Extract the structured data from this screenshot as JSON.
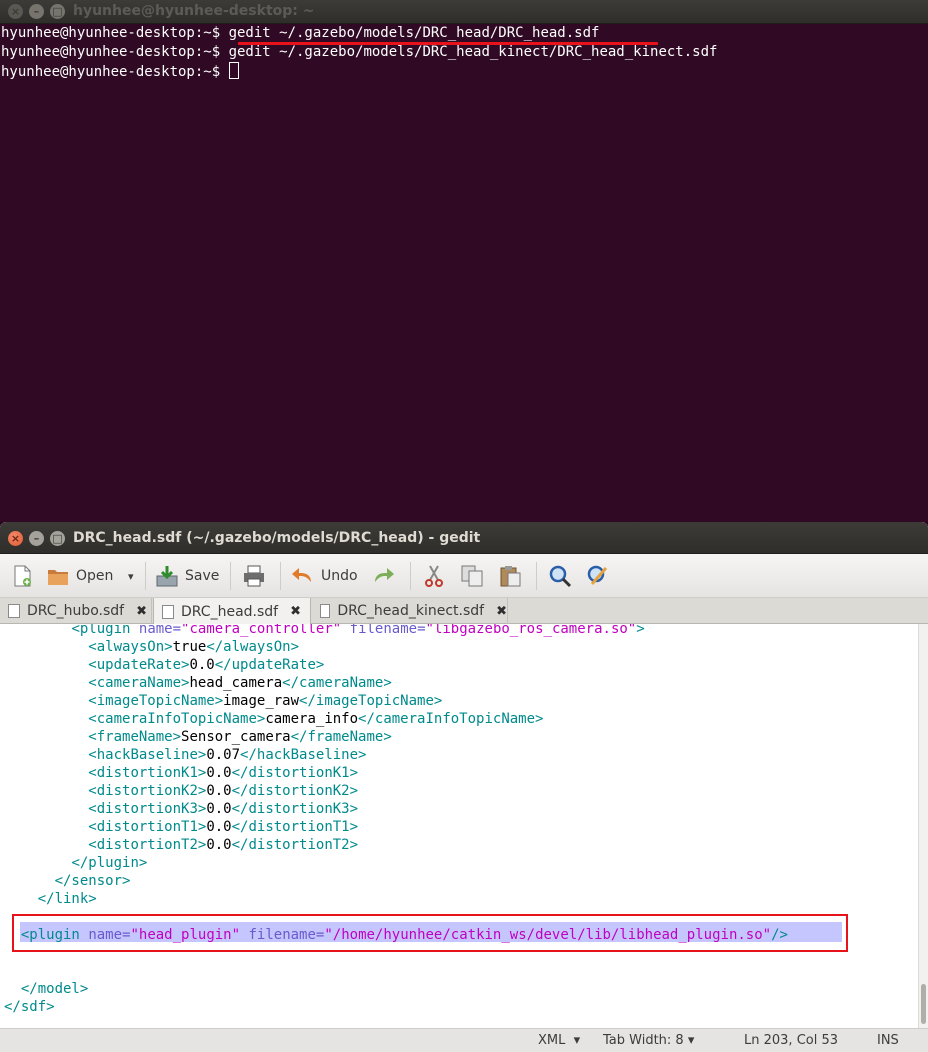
{
  "terminal": {
    "title": "hyunhee@hyunhee-desktop: ~",
    "lines": [
      {
        "prompt": "hyunhee@hyunhee-desktop:~$ ",
        "command": "gedit ~/.gazebo/models/DRC_head/DRC_head.sdf"
      },
      {
        "prompt": "hyunhee@hyunhee-desktop:~$ ",
        "command": "gedit ~/.gazebo/models/DRC_head_kinect/DRC_head_kinect.sdf"
      },
      {
        "prompt": "hyunhee@hyunhee-desktop:~$ ",
        "command": ""
      }
    ]
  },
  "gedit": {
    "title": "DRC_head.sdf (~/.gazebo/models/DRC_head) - gedit",
    "toolbar": {
      "open_label": "Open",
      "save_label": "Save",
      "undo_label": "Undo",
      "dropdown_glyph": "▾"
    },
    "tabs": [
      {
        "label": "DRC_hubo.sdf",
        "close": "✖"
      },
      {
        "label": "DRC_head.sdf",
        "close": "✖"
      },
      {
        "label": "DRC_head_kinect.sdf",
        "close": "✖"
      }
    ],
    "code": [
      "        <plugin name=\"camera_controller\" filename=\"libgazebo_ros_camera.so\">",
      "          <alwaysOn>true</alwaysOn>",
      "          <updateRate>0.0</updateRate>",
      "          <cameraName>head_camera</cameraName>",
      "          <imageTopicName>image_raw</imageTopicName>",
      "          <cameraInfoTopicName>camera_info</cameraInfoTopicName>",
      "          <frameName>Sensor_camera</frameName>",
      "          <hackBaseline>0.07</hackBaseline>",
      "          <distortionK1>0.0</distortionK1>",
      "          <distortionK2>0.0</distortionK2>",
      "          <distortionK3>0.0</distortionK3>",
      "          <distortionT1>0.0</distortionT1>",
      "          <distortionT2>0.0</distortionT2>",
      "        </plugin>",
      "      </sensor>",
      "    </link>",
      "",
      "  <plugin name=\"head_plugin\" filename=\"/home/hyunhee/catkin_ws/devel/lib/libhead_plugin.so\"/>",
      "",
      "",
      "  </model>",
      "</sdf>"
    ],
    "status": {
      "language": "XML",
      "tab_width": "Tab Width: 8",
      "position": "Ln 203, Col 53",
      "mode": "INS",
      "dropdown_glyph": "▾"
    }
  }
}
